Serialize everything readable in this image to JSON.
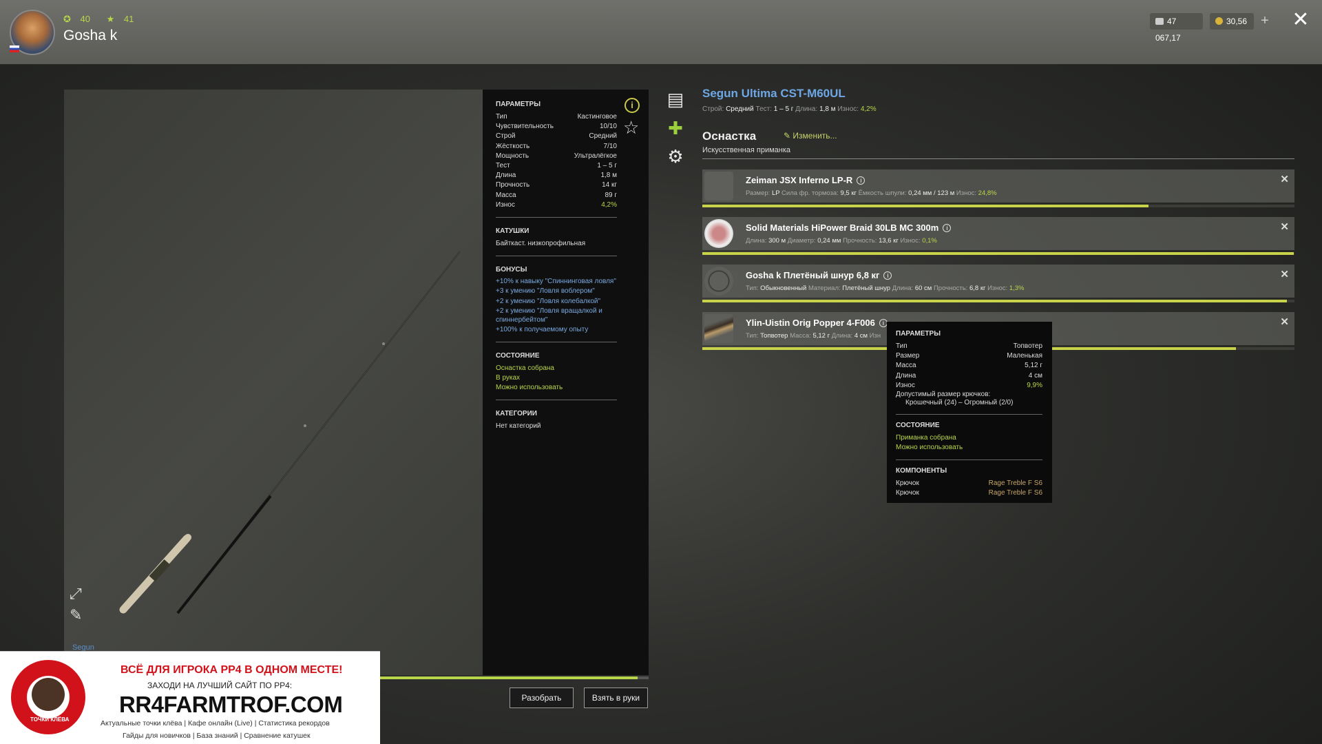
{
  "player": {
    "level_a": "40",
    "level_b": "41",
    "name": "Gosha k"
  },
  "currency": {
    "silver": "47 067,17",
    "gold": "30,56"
  },
  "params_panel": {
    "title": "ПАРАМЕТРЫ",
    "rows": [
      {
        "k": "Тип",
        "v": "Кастинговое"
      },
      {
        "k": "Чувствительность",
        "v": "10/10"
      },
      {
        "k": "Строй",
        "v": "Средний"
      },
      {
        "k": "Жёсткость",
        "v": "7/10"
      },
      {
        "k": "Мощность",
        "v": "Ультралёгкое"
      },
      {
        "k": "Тест",
        "v": "1 – 5 г"
      },
      {
        "k": "Длина",
        "v": "1,8 м"
      },
      {
        "k": "Прочность",
        "v": "14 кг"
      },
      {
        "k": "Масса",
        "v": "89 г"
      },
      {
        "k": "Износ",
        "v": "4,2%"
      }
    ],
    "reels_title": "КАТУШКИ",
    "reels_value": "Байткаст. низкопрофильная",
    "bonuses_title": "БОНУСЫ",
    "bonuses": [
      "+10% к навыку \"Спиннинговая ловля\"",
      "+3 к умению \"Ловля воблером\"",
      "+2 к умению \"Ловля колебалкой\"",
      "+2 к умению \"Ловля вращалкой и спиннербейтом\"",
      "+100% к получаемому опыту"
    ],
    "state_title": "СОСТОЯНИЕ",
    "state": [
      "Оснастка собрана",
      "В руках",
      "Можно использовать"
    ],
    "cat_title": "КАТЕГОРИИ",
    "cat_value": "Нет категорий"
  },
  "preview": {
    "brand": "Segun"
  },
  "rod": {
    "title": "Segun Ultima CST-M60UL",
    "sub": {
      "stroy_label": "Строй:",
      "stroy": "Средний",
      "test_label": "Тест:",
      "test": "1 – 5 г",
      "len_label": "Длина:",
      "len": "1,8 м",
      "wear_label": "Износ:",
      "wear": "4,2%"
    }
  },
  "tackle": {
    "title": "Оснастка",
    "edit": "Изменить...",
    "subtitle": "Искусственная приманка",
    "items": [
      {
        "name": "Zeiman JSX Inferno LP-R",
        "d1l": "Размер:",
        "d1": "LP",
        "d2l": "Сила фр. тормоза:",
        "d2": "9,5 кг",
        "d3l": "Ёмкость шпули:",
        "d3": "0,24 мм / 123 м",
        "d4l": "Износ:",
        "d4": "24,8%",
        "wear_fraction": 0.753
      },
      {
        "name": "Solid Materials HiPower Braid 30LB MC 300m",
        "d1l": "Длина:",
        "d1": "300 м",
        "d2l": "Диаметр:",
        "d2": "0,24 мм",
        "d3l": "Прочность:",
        "d3": "13,6 кг",
        "d4l": "Износ:",
        "d4": "0,1%",
        "wear_fraction": 0.999
      },
      {
        "name": "Gosha k Плетёный шнур 6,8 кг",
        "d1l": "Тип:",
        "d1": "Обыкновенный",
        "d2l": "Материал:",
        "d2": "Плетёный шнур",
        "d3l": "Длина:",
        "d3": "60 см",
        "d4l": "Прочность:",
        "d4": "6,8 кг",
        "d5l": "Износ:",
        "d5": "1,3%",
        "wear_fraction": 0.987
      },
      {
        "name": "Ylin-Uistin Orig Popper 4-F006",
        "d1l": "Тип:",
        "d1": "Топвотер",
        "d2l": "Масса:",
        "d2": "5,12 г",
        "d3l": "Длина:",
        "d3": "4 см",
        "d4l": "Изн",
        "wear_fraction": 0.901
      }
    ]
  },
  "tooltip": {
    "title": "ПАРАМЕТРЫ",
    "rows": [
      {
        "k": "Тип",
        "v": "Топвотер"
      },
      {
        "k": "Размер",
        "v": "Маленькая"
      },
      {
        "k": "Масса",
        "v": "5,12 г"
      },
      {
        "k": "Длина",
        "v": "4 см"
      },
      {
        "k": "Износ",
        "v": "9,9%"
      }
    ],
    "hook_label": "Допустимый размер крючков:",
    "hook_value": "Крошечный (24) – Огромный (2/0)",
    "state_title": "СОСТОЯНИЕ",
    "state": [
      "Приманка собрана",
      "Можно использовать"
    ],
    "comp_title": "КОМПОНЕНТЫ",
    "components": [
      {
        "k": "Крючок",
        "v": "Rage Treble F S6"
      },
      {
        "k": "Крючок",
        "v": "Rage Treble F S6"
      }
    ]
  },
  "buttons": {
    "disassemble": "Разобрать",
    "take": "Взять в руки"
  },
  "rod_wear_fraction": 0.958,
  "ad": {
    "h1": "ВСЁ ДЛЯ ИГРОКА РР4 В ОДНОМ МЕСТЕ!",
    "h2": "ЗАХОДИ НА ЛУЧШИЙ САЙТ ПО РР4:",
    "site": "RR4FARMTROF.COM",
    "line1": "Актуальные точки клёва  |  Кафе онлайн (Live)  |  Статистика рекордов",
    "line2": "Гайды для новичков  |  База знаний  |  Сравнение катушек",
    "logo_text": "ТОЧКИ КЛЁВА"
  },
  "colors": {
    "accent_green": "#b9d64a",
    "accent_blue": "#6ea7e6",
    "ad_red": "#d1121a"
  }
}
